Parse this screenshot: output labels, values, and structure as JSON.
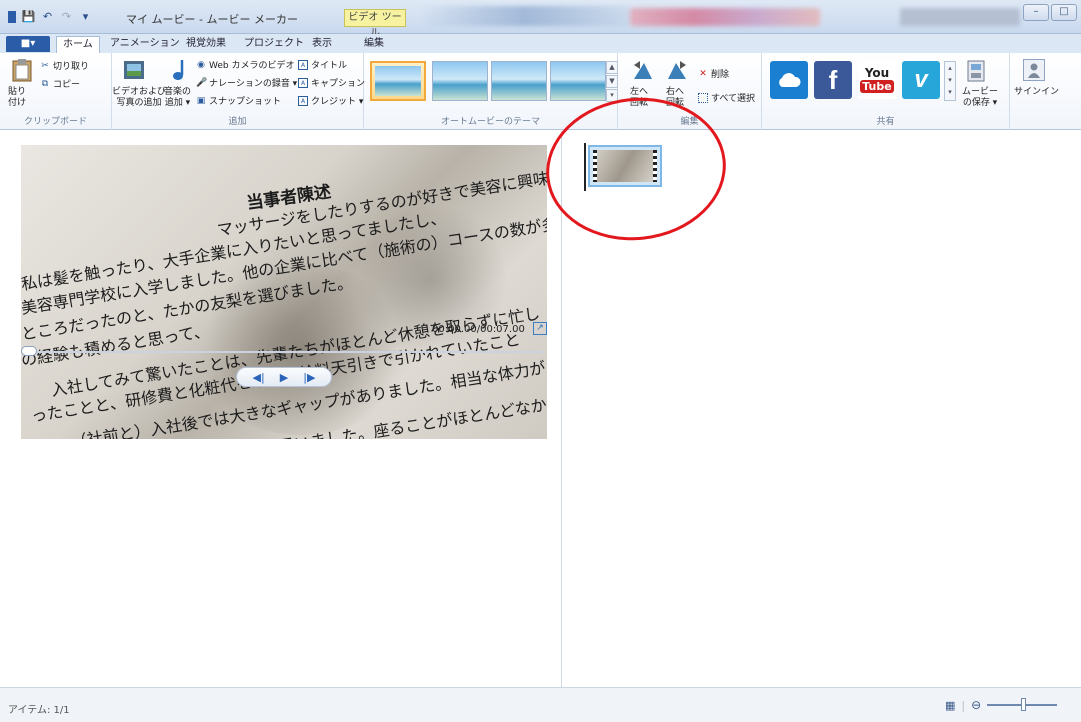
{
  "window": {
    "title": "マイ ムービー - ムービー メーカー",
    "context_tab": "ビデオ ツール",
    "buttons": {
      "minimize": "–",
      "maximize": "□"
    }
  },
  "tabs": {
    "file": "■▾",
    "items": [
      "ホーム",
      "アニメーション",
      "視覚効果",
      "プロジェクト",
      "表示",
      "編集"
    ]
  },
  "ribbon": {
    "clipboard": {
      "paste": "貼り\n付け",
      "cut": "切り取り",
      "copy": "コピー",
      "label": "クリップボード"
    },
    "add": {
      "add_video_photos": "ビデオおよび\n写真の追加",
      "add_music": "音楽の\n追加 ▾",
      "webcam_video": "Web カメラのビデオ",
      "record_narration": "ナレーションの録音 ▾",
      "snapshot": "スナップショット",
      "title": "タイトル",
      "caption": "キャプション",
      "credits": "クレジット ▾",
      "label": "追加"
    },
    "themes": {
      "label": "オートムービーのテーマ"
    },
    "editing": {
      "rotate_left": "左へ\n回転",
      "rotate_right": "右へ\n回転",
      "remove": "削除",
      "select_all": "すべて選択",
      "label": "編集"
    },
    "share": {
      "youtube_top": "You",
      "youtube_bottom": "Tube",
      "save_movie": "ムービー\nの保存 ▾",
      "sign_in": "サインイン",
      "label": "共有"
    }
  },
  "preview": {
    "doc_title": "当事者陳述",
    "doc_lines": [
      "マッサージをしたりするのが好きで美容に興味を持",
      "私は髪を触ったり、大手企業に入りたいと思ってましたし、",
      "美容専門学校に入学しました。他の企業に比べて（施術の）コースの数が多いため",
      "ところだったのと、たかの友梨を選びました。",
      "の経験も積めると思って、",
      "入社してみて驚いたことは、先輩たちがほとんど休憩を取らずに忙し",
      "ったことと、研修費と化粧代を最初に給料天引きで引かれていたこと",
      "（社前と）入社後では大きなギャップがありました。相当な体力が",
      "だなと思いました。座ることがほとんどなかっ"
    ],
    "time": "00:00.00/00:07.00"
  },
  "player": {
    "prev_frame": "◀|",
    "play": "▶",
    "next_frame": "|▶"
  },
  "status": {
    "items": "アイテム: 1/1"
  }
}
